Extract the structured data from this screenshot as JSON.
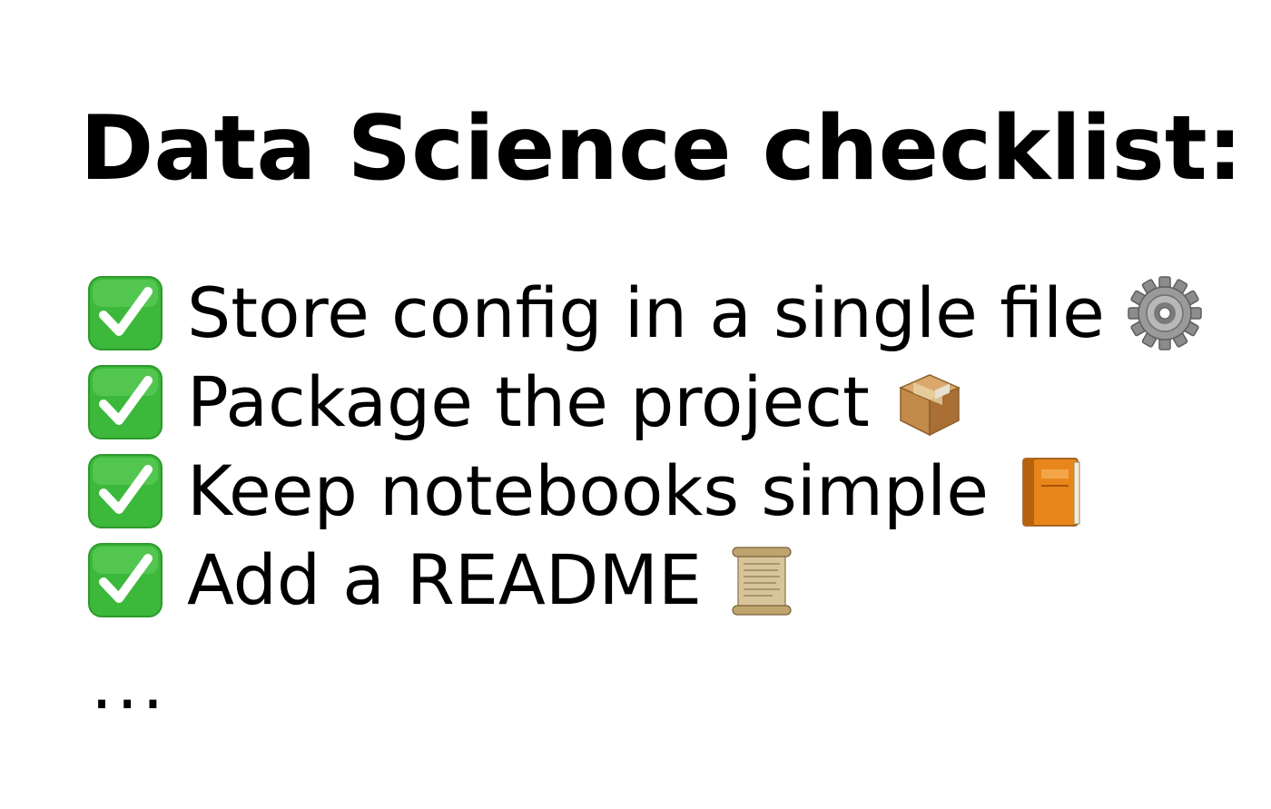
{
  "title": "Data Science checklist:",
  "items": [
    {
      "label": "Store config in a single file",
      "icon": "gear-icon"
    },
    {
      "label": "Package the project",
      "icon": "package-icon"
    },
    {
      "label": "Keep notebooks simple",
      "icon": "book-icon"
    },
    {
      "label": "Add a README",
      "icon": "scroll-icon"
    }
  ],
  "ellipsis": "...",
  "colors": {
    "check_green": "#3cb83a",
    "check_mark": "#ffffff",
    "text": "#000000",
    "background": "#ffffff"
  }
}
